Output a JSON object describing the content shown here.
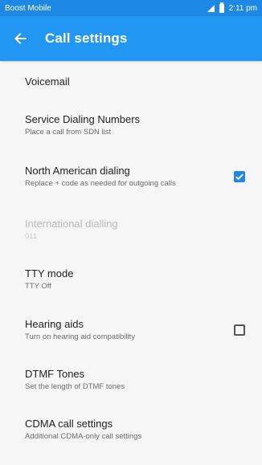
{
  "status_bar": {
    "carrier": "Boost Mobile",
    "time": "2:11 pm"
  },
  "toolbar": {
    "title": "Call settings",
    "back_icon": "arrow-left-icon"
  },
  "colors": {
    "status_bar": "#1e88e5",
    "toolbar": "#2196f3",
    "background": "#f6f6f6",
    "checkbox_checked": "#1e88e5"
  },
  "items": [
    {
      "title": "Voicemail",
      "subtitle": ""
    },
    {
      "title": "Service Dialing Numbers",
      "subtitle": "Place a call from SDN list"
    },
    {
      "title": "North American dialing",
      "subtitle": "Replace + code as needed for outgoing calls",
      "checkbox": true,
      "checked": true
    },
    {
      "title": "International dialling",
      "subtitle": "011",
      "disabled": true
    },
    {
      "title": "TTY mode",
      "subtitle": "TTY Off"
    },
    {
      "title": "Hearing aids",
      "subtitle": "Turn on hearing aid compatibility",
      "checkbox": true,
      "checked": false
    },
    {
      "title": "DTMF Tones",
      "subtitle": "Set the length of DTMF tones"
    },
    {
      "title": "CDMA call settings",
      "subtitle": "Additional CDMA-only call settings"
    }
  ]
}
